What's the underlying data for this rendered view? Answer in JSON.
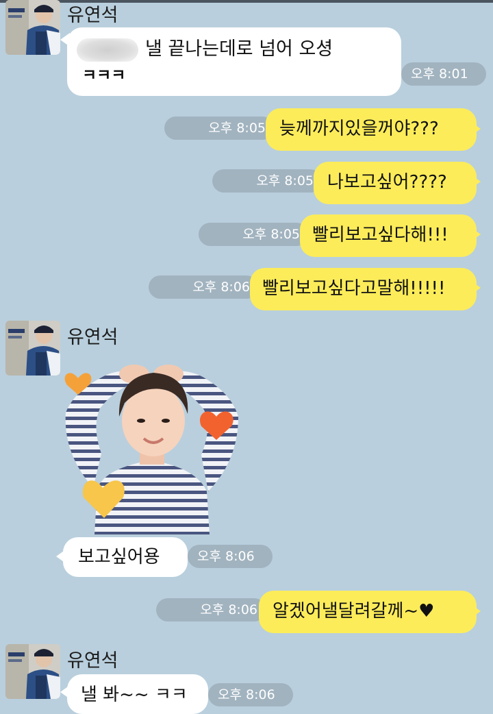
{
  "contact_name": "유연석",
  "messages": [
    {
      "id": "m1",
      "sender": "them",
      "lines": [
        "낼 끝나는데로 넘어 오셩",
        "ㅋㅋㅋ"
      ],
      "time": "오후 8:01"
    },
    {
      "id": "m2",
      "sender": "me",
      "text": "늦께까지있을꺼야???",
      "time": "오후 8:05"
    },
    {
      "id": "m3",
      "sender": "me",
      "text": "나보고싶어????",
      "time": "오후 8:05"
    },
    {
      "id": "m4",
      "sender": "me",
      "text": "빨리보고싶다해!!!",
      "time": "오후 8:05"
    },
    {
      "id": "m5",
      "sender": "me",
      "text": "빨리보고싶다고말해!!!!!",
      "time": "오후 8:06"
    },
    {
      "id": "m6",
      "sender": "them",
      "text": "보고싶어용",
      "time": "오후 8:06",
      "sticker": "heart-pose-sticker"
    },
    {
      "id": "m7",
      "sender": "me",
      "text": "알겠어낼달려갈께~♥",
      "time": "오후 8:06"
    },
    {
      "id": "m8",
      "sender": "them",
      "text": "낼 봐~~ ㅋㅋ",
      "time": "오후 8:06"
    }
  ],
  "colors": {
    "background": "#b9cfdd",
    "my_bubble": "#fcec5a",
    "their_bubble": "#ffffff",
    "time_pill": "#a1b3bf"
  },
  "icons": {
    "avatar": "profile-photo-icon",
    "sticker": "heart-pose-sticker-image"
  }
}
